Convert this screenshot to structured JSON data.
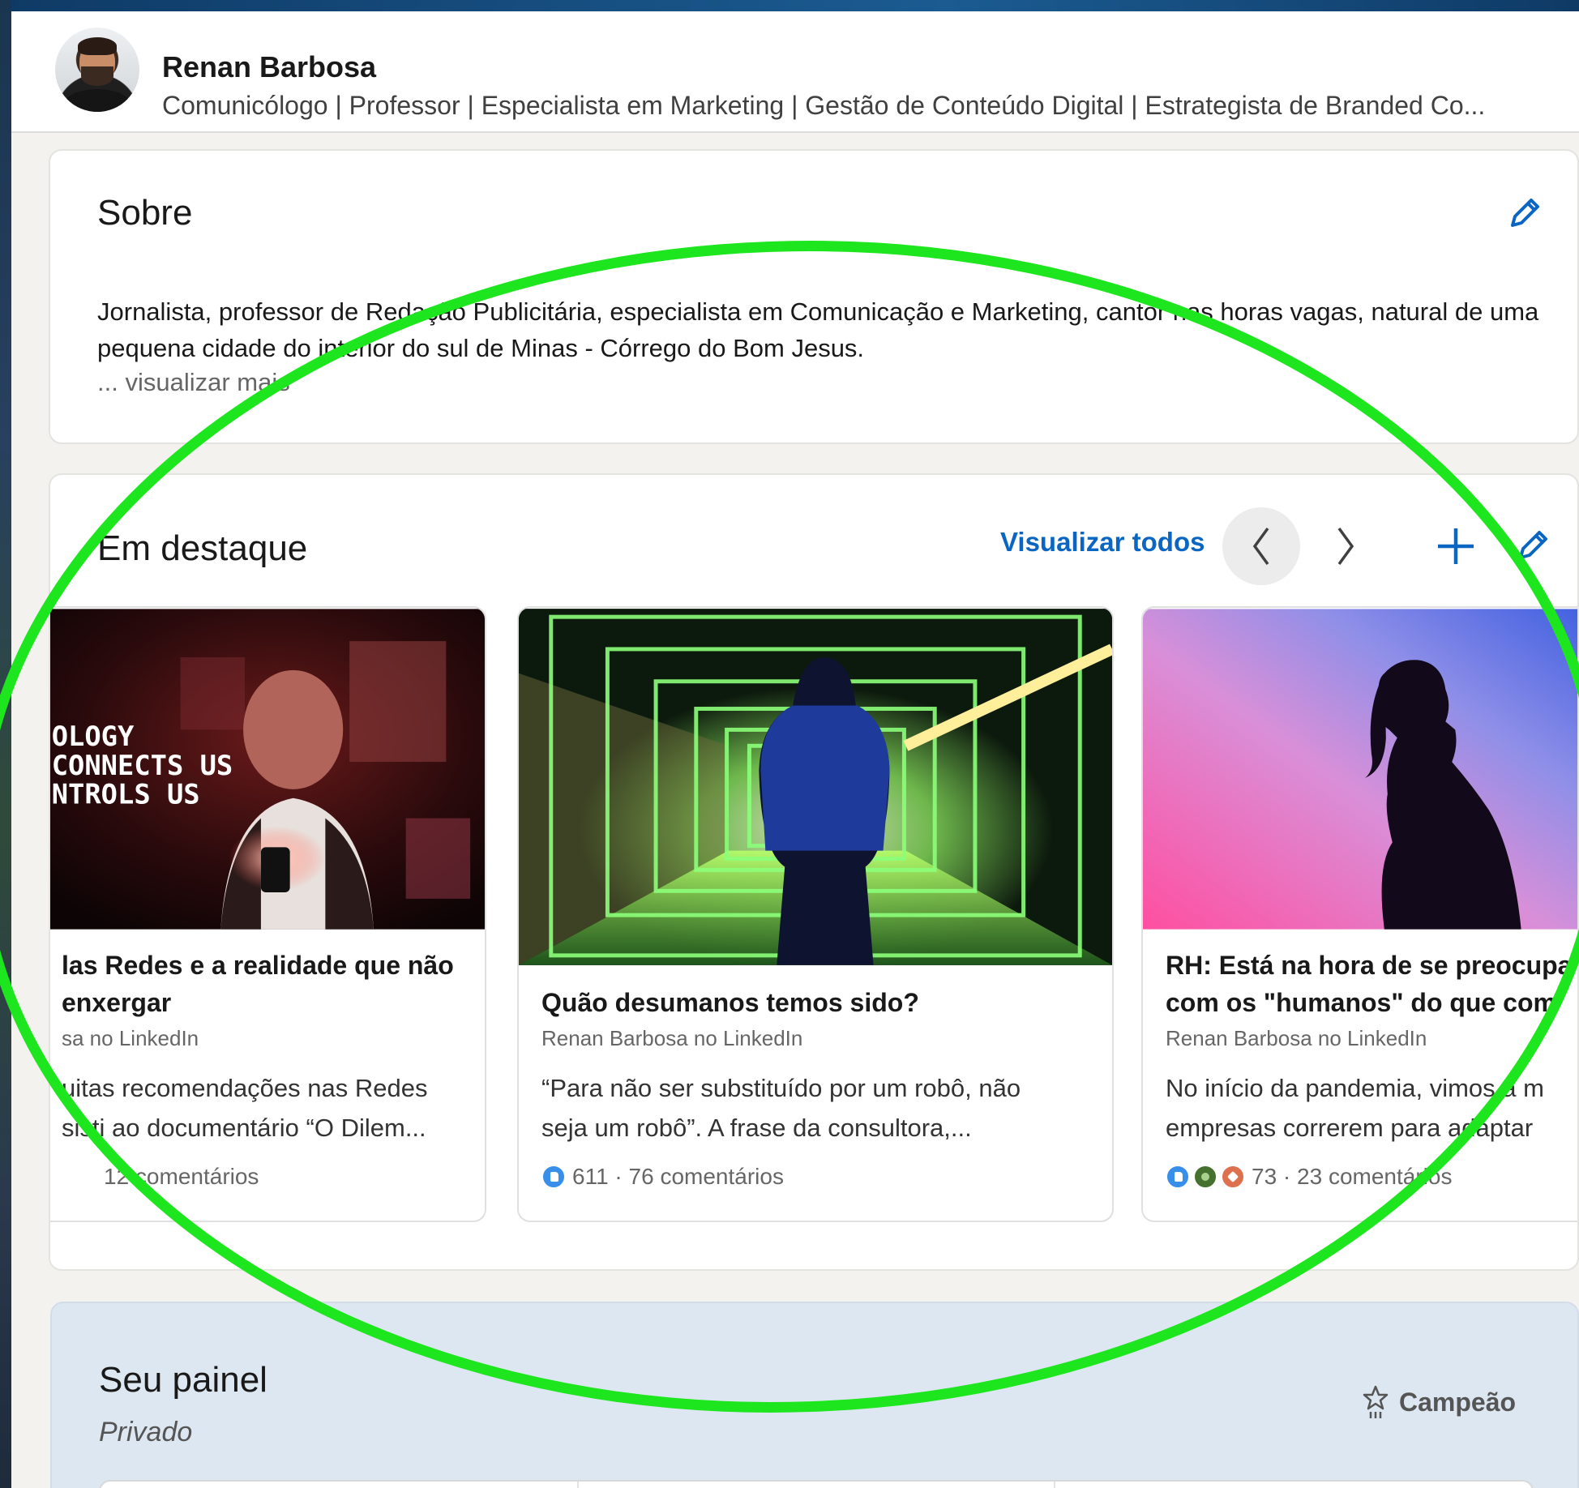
{
  "profile": {
    "name": "Renan Barbosa",
    "headline": "Comunicólogo | Professor | Especialista em Marketing | Gestão de Conteúdo Digital | Estrategista de Branded Co..."
  },
  "about": {
    "title": "Sobre",
    "text": "Jornalista, professor de Redação Publicitária, especialista em Comunicação e Marketing, cantor nas horas vagas, natural de uma pequena cidade do interior do sul de Minas - Córrego do Bom Jesus.",
    "see_more": "... visualizar mais"
  },
  "featured": {
    "title": "Em destaque",
    "view_all": "Visualizar todos",
    "items": [
      {
        "title_line1": "las Redes e a realidade que não",
        "title_line2": "enxergar",
        "source": "sa no LinkedIn",
        "desc_line1": "uitas recomendações nas Redes",
        "desc_line2": "sisti ao documentário “O Dilem...",
        "stats": "12 comentários",
        "thumb_text_1": "OLOGY",
        "thumb_text_2": "CONNECTS US",
        "thumb_text_3": "NTROLS US"
      },
      {
        "title": "Quão desumanos temos sido?",
        "source": "Renan Barbosa no LinkedIn",
        "desc_line1": "“Para não ser substituído por um robô, não",
        "desc_line2": "seja um robô”. A frase da consultora,...",
        "stats": "611 · 76 comentários"
      },
      {
        "title_line1": "RH: Está na hora de se preocupa",
        "title_line2": "com os \"humanos\" do que com",
        "source": "Renan Barbosa no LinkedIn",
        "desc_line1": "No início da pandemia, vimos a m",
        "desc_line2": "empresas correrem para adaptar",
        "stats": "73 · 23 comentários"
      }
    ]
  },
  "dashboard": {
    "title": "Seu painel",
    "private_label": "Privado",
    "level": "Campeão"
  },
  "colors": {
    "accent": "#0a66c2",
    "annotation": "#1ee61e",
    "dashboard_bg": "#dde7f1"
  },
  "icons": [
    "pencil-icon",
    "chevron-left-icon",
    "chevron-right-icon",
    "plus-icon",
    "like-reaction-icon",
    "celebrate-reaction-icon",
    "love-reaction-icon",
    "star-icon"
  ]
}
